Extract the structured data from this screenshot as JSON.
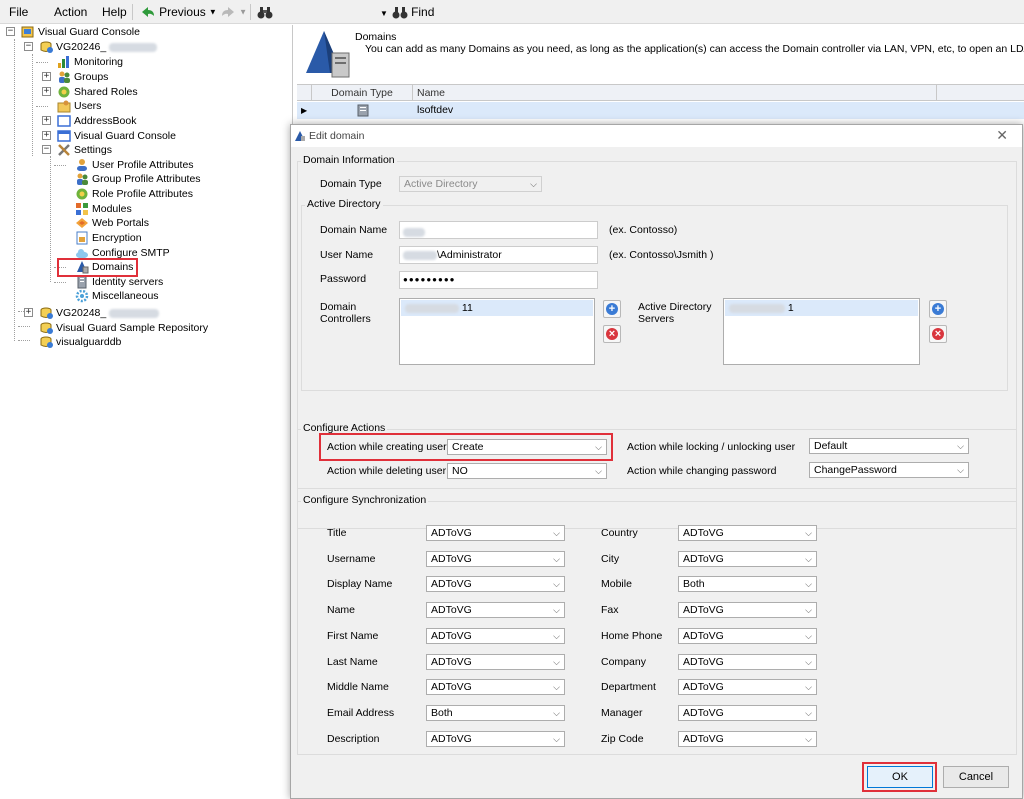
{
  "menu": {
    "file": "File",
    "action": "Action",
    "help": "Help",
    "previous": "Previous",
    "find": "Find"
  },
  "tree": {
    "root": "Visual Guard Console",
    "repo1": "VG20246_",
    "monitoring": "Monitoring",
    "groups": "Groups",
    "shared_roles": "Shared Roles",
    "users": "Users",
    "addressbook": "AddressBook",
    "vg_console": "Visual Guard Console",
    "settings": "Settings",
    "upa": "User Profile Attributes",
    "gpa": "Group Profile Attributes",
    "rpa": "Role Profile Attributes",
    "modules": "Modules",
    "web_portals": "Web Portals",
    "encryption": "Encryption",
    "smtp": "Configure SMTP",
    "domains": "Domains",
    "identity": "Identity servers",
    "misc": "Miscellaneous",
    "repo2": "VG20248_",
    "sample": "Visual Guard Sample Repository",
    "vgdb": "visualguarddb"
  },
  "pane": {
    "title": "Domains",
    "description": "You can add as many Domains as you need, as long as the application(s) can access the Domain controller via LAN, VPN, etc, to open an LDAP",
    "col_type": "Domain Type",
    "col_name": "Name",
    "row_name": "lsoftdev"
  },
  "dialog": {
    "title": "Edit domain",
    "close": "✕",
    "domain_info": "Domain Information",
    "domain_type_label": "Domain Type",
    "domain_type_value": "Active Directory",
    "ad_group": "Active Directory",
    "domain_name_label": "Domain Name",
    "domain_name_hint": "(ex. Contosso)",
    "user_name_label": "User Name",
    "user_name_value": "\\Administrator",
    "user_name_hint": "(ex. Contosso\\Jsmith )",
    "password_label": "Password",
    "password_value": "●●●●●●●●●",
    "dc_label_1": "Domain",
    "dc_label_2": "Controllers",
    "dc_item": "11",
    "ads_label_1": "Active Directory",
    "ads_label_2": "Servers",
    "ads_item": "1",
    "actions_group": "Configure Actions",
    "create_label": "Action while creating user",
    "create_value": "Create",
    "delete_label": "Action while deleting user",
    "delete_value": "NO",
    "lock_label": "Action while locking / unlocking user",
    "lock_value": "Default",
    "pwd_label": "Action while changing password",
    "pwd_value": "ChangePassword",
    "sync_group": "Configure Synchronization",
    "sync_left": [
      {
        "label": "Title",
        "value": "ADToVG"
      },
      {
        "label": "Username",
        "value": "ADToVG"
      },
      {
        "label": "Display Name",
        "value": "ADToVG"
      },
      {
        "label": "Name",
        "value": "ADToVG"
      },
      {
        "label": "First Name",
        "value": "ADToVG"
      },
      {
        "label": "Last Name",
        "value": "ADToVG"
      },
      {
        "label": "Middle Name",
        "value": "ADToVG"
      },
      {
        "label": "Email Address",
        "value": "Both"
      },
      {
        "label": "Description",
        "value": "ADToVG"
      }
    ],
    "sync_right": [
      {
        "label": "Country",
        "value": "ADToVG"
      },
      {
        "label": "City",
        "value": "ADToVG"
      },
      {
        "label": "Mobile",
        "value": "Both"
      },
      {
        "label": "Fax",
        "value": "ADToVG"
      },
      {
        "label": "Home Phone",
        "value": "ADToVG"
      },
      {
        "label": "Company",
        "value": "ADToVG"
      },
      {
        "label": "Department",
        "value": "ADToVG"
      },
      {
        "label": "Manager",
        "value": "ADToVG"
      },
      {
        "label": "Zip Code",
        "value": "ADToVG"
      }
    ],
    "ok": "OK",
    "cancel": "Cancel"
  },
  "colors": {
    "highlight": "#e0303a",
    "selection": "#dbe9fa",
    "dialog_bg": "#f0f0f0"
  }
}
